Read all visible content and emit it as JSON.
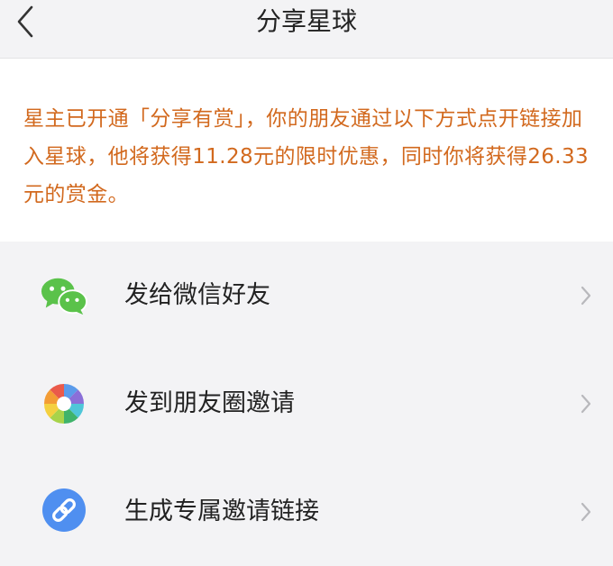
{
  "header": {
    "title": "分享星球",
    "back_icon": "chevron-left-icon"
  },
  "notice": {
    "text": "星主已开通「分享有赏」，你的朋友通过以下方式点开链接加入星球，他将获得11.28元的限时优惠，同时你将获得26.33元的赏金。",
    "color": "#d2691e",
    "friend_discount": "11.28元",
    "reward": "26.33元"
  },
  "share_options": [
    {
      "label": "发给微信好友",
      "icon": "wechat-icon",
      "color": "#5ac24a"
    },
    {
      "label": "发到朋友圈邀请",
      "icon": "moments-icon",
      "color": "#5aa0e8"
    },
    {
      "label": "生成专属邀请链接",
      "icon": "link-icon",
      "color": "#4f8ff0"
    }
  ],
  "colors": {
    "background": "#f3f3f5",
    "panel": "#ffffff",
    "text": "#222222",
    "chevron": "#b8b8bc"
  }
}
